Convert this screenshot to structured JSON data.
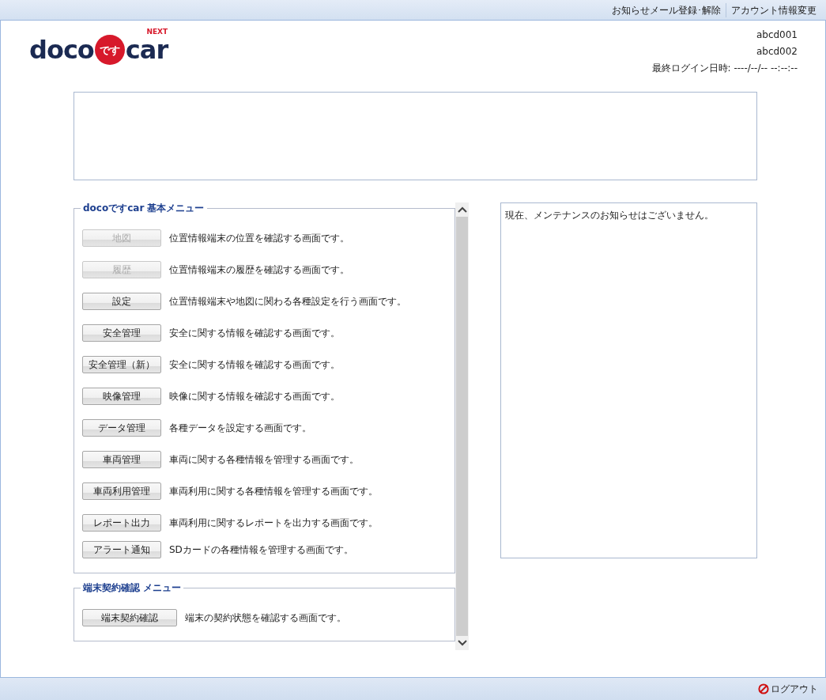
{
  "top_links": [
    "お知らせメール登録･解除",
    "アカウント情報変更"
  ],
  "logo": {
    "left": "doco",
    "circle": "です",
    "right": "car",
    "badge": "NEXT"
  },
  "user": {
    "lines": [
      "abcd001",
      "abcd002"
    ],
    "last_login": "最終ログイン日時: ----/--/-- --:--:--"
  },
  "basic_menu": {
    "title": "docoですcar 基本メニュー",
    "items": [
      {
        "label": "地図",
        "description": "位置情報端末の位置を確認する画面です。",
        "disabled": true
      },
      {
        "label": "履歴",
        "description": "位置情報端末の履歴を確認する画面です。",
        "disabled": true
      },
      {
        "label": "設定",
        "description": "位置情報端末や地図に関わる各種設定を行う画面です。",
        "disabled": false
      },
      {
        "label": "安全管理",
        "description": "安全に関する情報を確認する画面です。",
        "disabled": false
      },
      {
        "label": "安全管理（新）",
        "description": "安全に関する情報を確認する画面です。",
        "disabled": false
      },
      {
        "label": "映像管理",
        "description": "映像に関する情報を確認する画面です。",
        "disabled": false
      },
      {
        "label": "データ管理",
        "description": "各種データを設定する画面です。",
        "disabled": false
      },
      {
        "label": "車両管理",
        "description": "車両に関する各種情報を管理する画面です。",
        "disabled": false
      },
      {
        "label": "車両利用管理",
        "description": "車両利用に関する各種情報を管理する画面です。",
        "disabled": false
      },
      {
        "label": "レポート出力",
        "description": "車両利用に関するレポートを出力する画面です。",
        "disabled": false
      },
      {
        "label": "アラート通知",
        "description": "SDカードの各種情報を管理する画面です。",
        "disabled": false
      }
    ]
  },
  "contract_menu": {
    "title": "端末契約確認 メニュー",
    "items": [
      {
        "label": "端末契約確認",
        "description": "端末の契約状態を確認する画面です。",
        "disabled": false
      }
    ]
  },
  "notice": "現在、メンテナンスのお知らせはございません。",
  "logout": "ログアウト"
}
